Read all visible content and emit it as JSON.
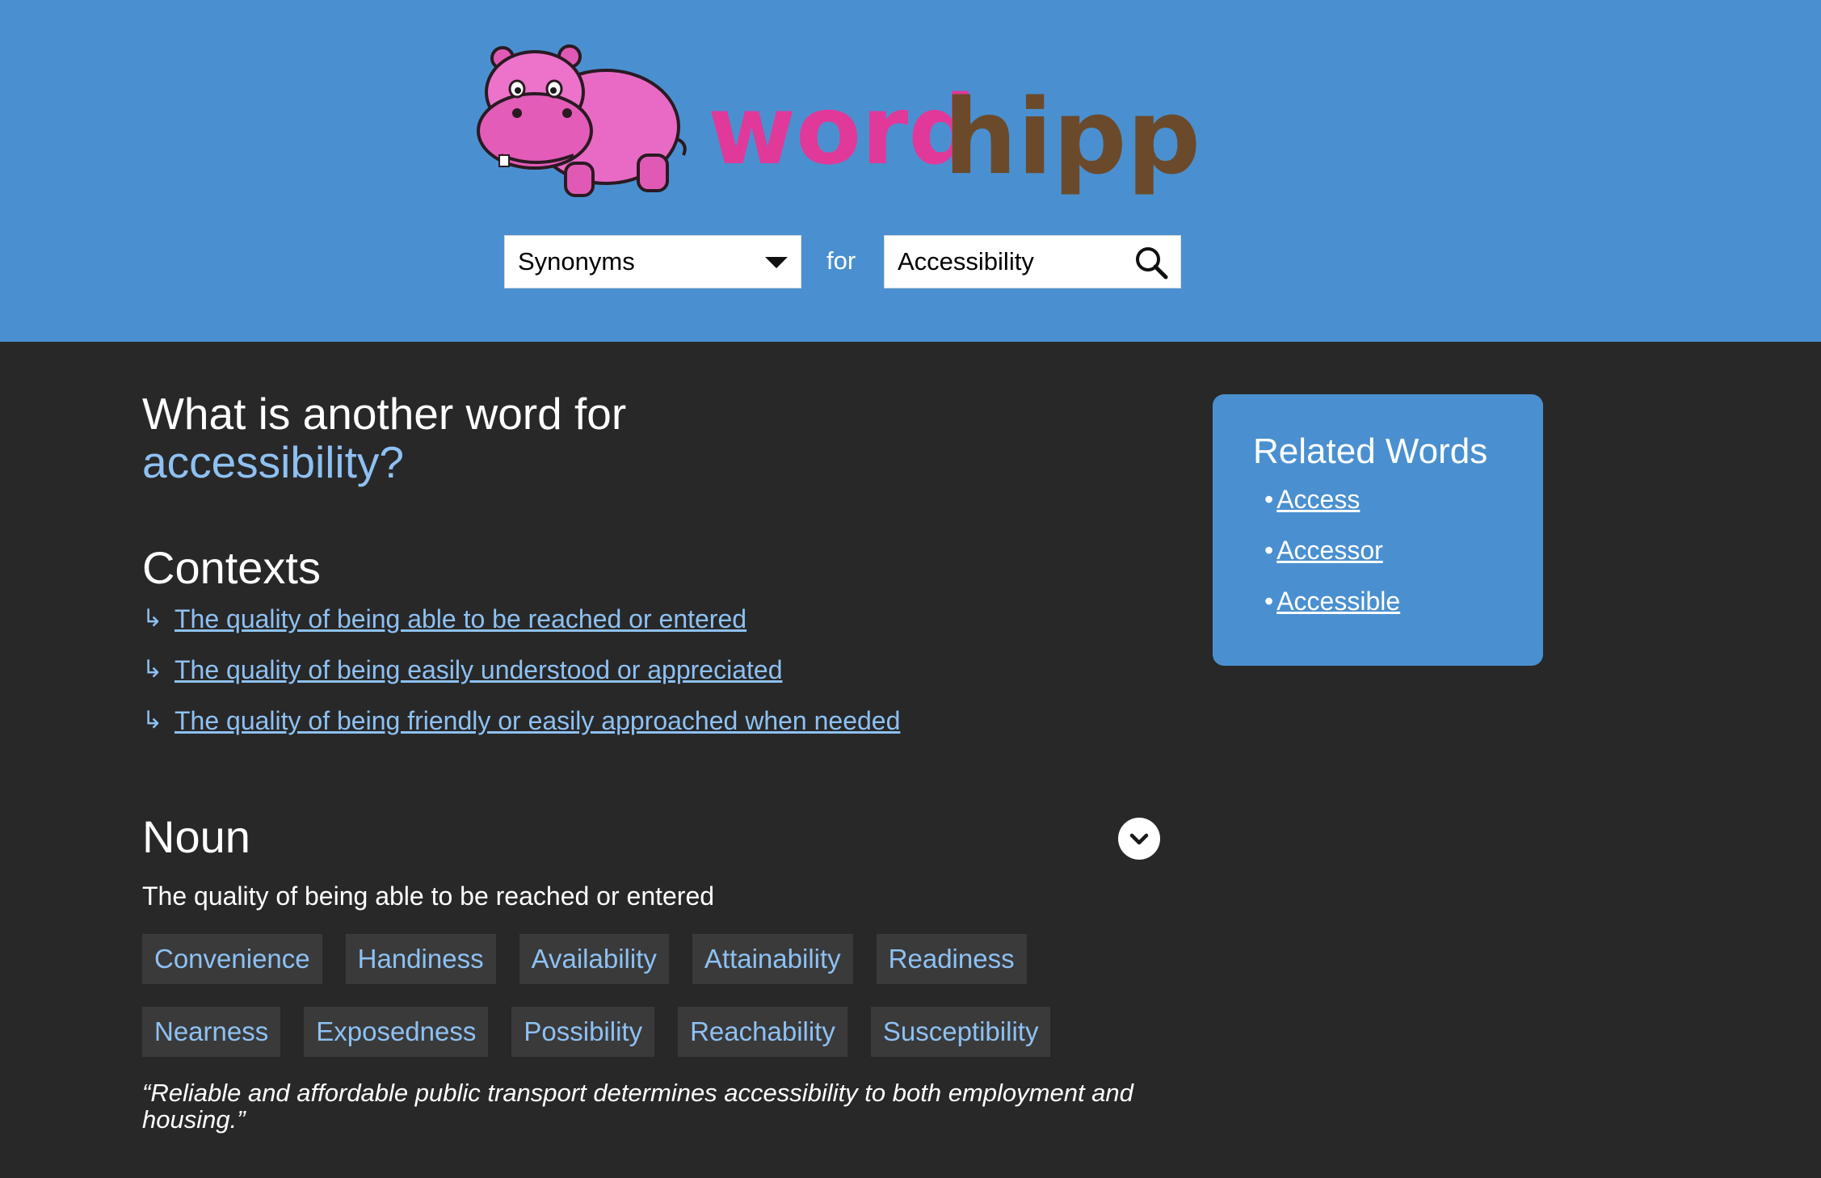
{
  "brand": {
    "name_part1": "word",
    "name_part2": "hippo",
    "colors": {
      "header_bg": "#4a90d0",
      "pink": "#e0399a",
      "brown": "#6b4a2b",
      "page_bg": "#282828",
      "link": "#8ec1f3"
    }
  },
  "search": {
    "type_selected": "Synonyms",
    "for_label": "for",
    "query": "Accessibility",
    "button_icon": "search-icon"
  },
  "main": {
    "title_prefix": "What is another word for",
    "title_word": "accessibility?"
  },
  "contexts": {
    "heading": "Contexts",
    "arrow": "↳",
    "items": [
      {
        "label": "The quality of being able to be reached or entered"
      },
      {
        "label": "The quality of being easily understood or appreciated"
      },
      {
        "label": "The quality of being friendly or easily approached when needed"
      }
    ]
  },
  "noun": {
    "heading": "Noun",
    "definition": "The quality of being able to be reached or entered",
    "synonyms_row1": [
      "Convenience",
      "Handiness",
      "Availability",
      "Attainability",
      "Readiness"
    ],
    "synonyms_row2": [
      "Nearness",
      "Exposedness",
      "Possibility",
      "Reachability",
      "Susceptibility"
    ],
    "example": "“Reliable and affordable public transport determines accessibility to both employment and housing.”"
  },
  "related": {
    "heading": "Related Words",
    "bullet": "•",
    "items": [
      {
        "label": "Access"
      },
      {
        "label": "Accessor"
      },
      {
        "label": "Accessible"
      }
    ]
  }
}
